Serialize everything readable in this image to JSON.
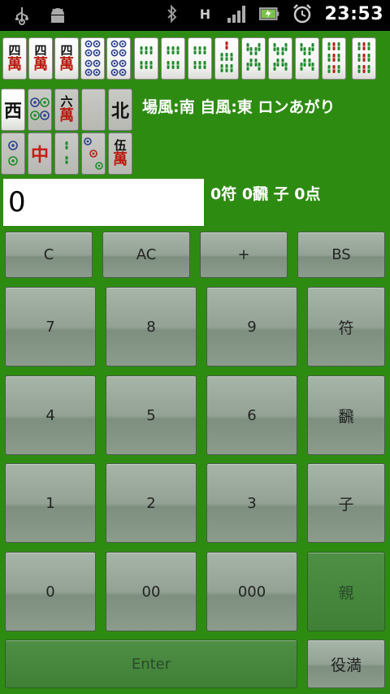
{
  "status_bar": {
    "time": "23:53",
    "h_badge": "H",
    "icons": [
      "usb-icon",
      "android-debug-icon",
      "bluetooth-icon",
      "signal-icon",
      "battery-icon",
      "alarm-icon"
    ]
  },
  "hand_tiles": [
    {
      "kind": "man",
      "num": "四"
    },
    {
      "kind": "man",
      "num": "四"
    },
    {
      "kind": "man",
      "num": "四"
    },
    {
      "kind": "pin",
      "count": 8
    },
    {
      "kind": "pin",
      "count": 8
    },
    {
      "kind": "sou",
      "count": 6
    },
    {
      "kind": "sou",
      "count": 6
    },
    {
      "kind": "sou",
      "count": 6
    },
    {
      "kind": "sou",
      "count": 7
    },
    {
      "kind": "sou",
      "count": 8
    },
    {
      "kind": "sou",
      "count": 8
    },
    {
      "kind": "sou",
      "count": 8
    },
    {
      "kind": "sou",
      "count": 9
    },
    {
      "kind": "sou",
      "count": 9
    }
  ],
  "selector_tiles_row1": [
    {
      "kind": "honor",
      "char": "西",
      "color": "black"
    },
    {
      "kind": "pin",
      "count": 4
    },
    {
      "kind": "man",
      "num": "六"
    },
    {
      "kind": "blank"
    },
    {
      "kind": "honor",
      "char": "北",
      "color": "black"
    }
  ],
  "selector_tiles_row2": [
    {
      "kind": "pin",
      "count": 2
    },
    {
      "kind": "honor",
      "char": "中",
      "color": "red"
    },
    {
      "kind": "sou",
      "count": 2
    },
    {
      "kind": "pin",
      "count": 3
    },
    {
      "kind": "man",
      "num": "伍"
    }
  ],
  "info": {
    "wind_line": "場風:南 自風:東 ロンあがり",
    "score_line": "0符 0飜 子 0点"
  },
  "display": {
    "value": "0"
  },
  "buttons": {
    "c": "C",
    "ac": "AC",
    "plus": "+",
    "bs": "BS",
    "n7": "7",
    "n8": "8",
    "n9": "9",
    "fu": "符",
    "n4": "4",
    "n5": "5",
    "n6": "6",
    "han": "飜",
    "n1": "1",
    "n2": "2",
    "n3": "3",
    "ko": "子",
    "n0": "0",
    "n00": "00",
    "n000": "000",
    "oya": "親",
    "enter": "Enter",
    "yakuman": "役満"
  },
  "colors": {
    "background": "#2e8b12",
    "man_red": "#b81c10",
    "sou_green": "#1f8a2a",
    "pin_blue": "#2a3f8a"
  }
}
